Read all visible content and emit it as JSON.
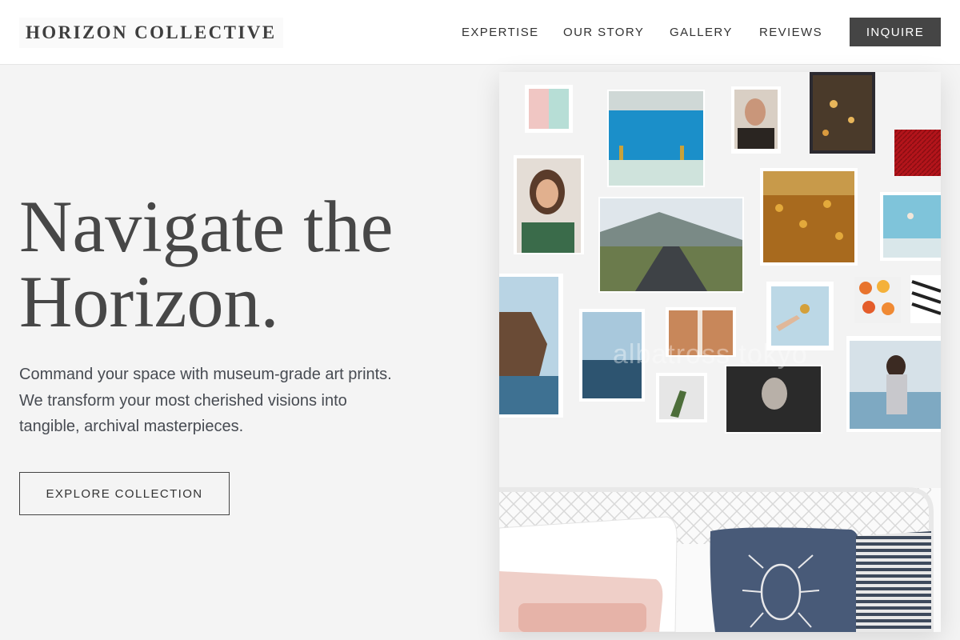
{
  "header": {
    "logo": "HORIZON COLLECTIVE",
    "nav": [
      "EXPERTISE",
      "OUR STORY",
      "GALLERY",
      "REVIEWS"
    ],
    "cta": "INQUIRE"
  },
  "hero": {
    "title_line1": "Navigate the",
    "title_line2": "Horizon.",
    "description": "Command your space with museum-grade art prints. We transform your most cherished visions into tangible, archival masterpieces.",
    "button": "EXPLORE COLLECTION"
  },
  "image": {
    "watermark": "albatross tokyo"
  }
}
